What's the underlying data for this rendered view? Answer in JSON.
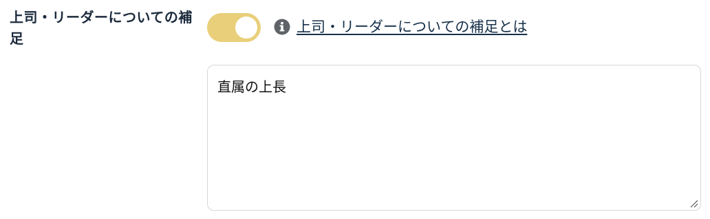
{
  "field": {
    "label": "上司・リーダーについての補足"
  },
  "toggle": {
    "state": "on",
    "color": "#e9cf7a"
  },
  "help": {
    "icon": "info-icon",
    "link_text": "上司・リーダーについての補足とは"
  },
  "textarea": {
    "value": "直属の上長"
  }
}
